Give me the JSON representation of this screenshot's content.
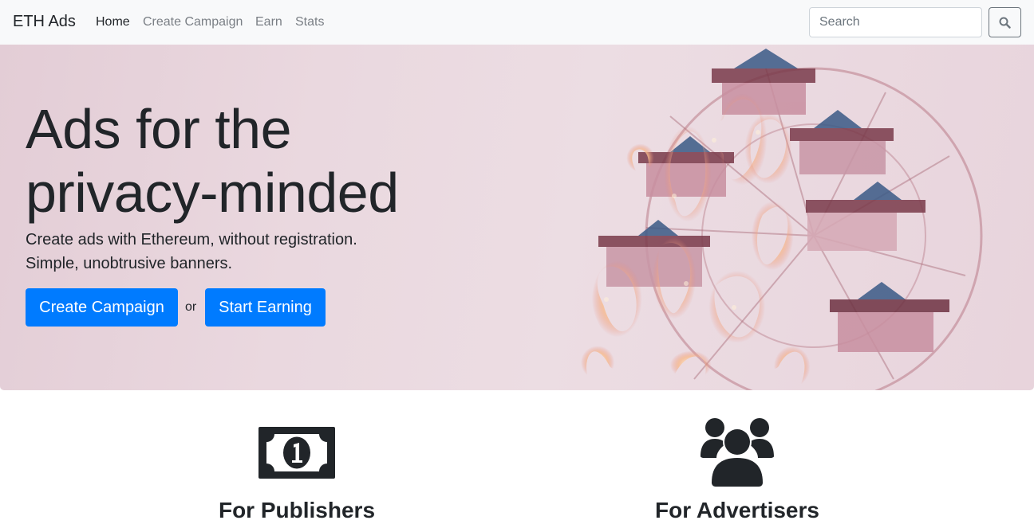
{
  "navbar": {
    "brand": "ETH Ads",
    "links": [
      "Home",
      "Create Campaign",
      "Earn",
      "Stats"
    ],
    "search_placeholder": "Search"
  },
  "hero": {
    "title_line1": "Ads for the",
    "title_line2": "privacy-minded",
    "subtitle_line1": "Create ads with Ethereum, without registration.",
    "subtitle_line2": "Simple, unobtrusive banners.",
    "primary_button": "Create Campaign",
    "separator": "or",
    "secondary_button": "Start Earning"
  },
  "features": [
    {
      "icon": "money-bill-icon",
      "title": "For Publishers"
    },
    {
      "icon": "users-icon",
      "title": "For Advertisers"
    }
  ],
  "colors": {
    "primary": "#007bff",
    "navbar_bg": "#f8f9fa",
    "text": "#212529"
  }
}
